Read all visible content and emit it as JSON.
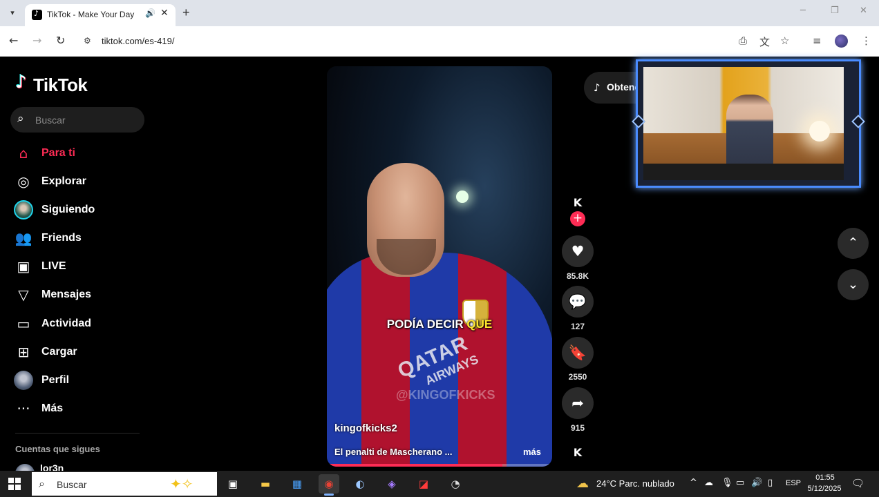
{
  "browser": {
    "tab_title": "TikTok - Make Your Day",
    "url": "tiktok.com/es-419/",
    "icons": [
      "tab-list-icon",
      "tiktok-favicon",
      "speaker-icon",
      "close-icon",
      "plus-icon",
      "minimize-icon",
      "maximize-icon",
      "close-window-icon",
      "back-icon",
      "forward-icon",
      "reload-icon",
      "site-info-icon",
      "install-icon",
      "translate-icon",
      "star-icon",
      "media-icon",
      "profile-avatar",
      "menu-icon"
    ]
  },
  "sidebar": {
    "logo": "TikTok",
    "search_placeholder": "Buscar",
    "nav": [
      {
        "label": "Para ti",
        "icon": "home-icon",
        "active": true
      },
      {
        "label": "Explorar",
        "icon": "compass-icon"
      },
      {
        "label": "Siguiendo",
        "icon": "following-avatar"
      },
      {
        "label": "Friends",
        "icon": "friends-icon"
      },
      {
        "label": "LIVE",
        "icon": "live-icon"
      },
      {
        "label": "Mensajes",
        "icon": "send-icon"
      },
      {
        "label": "Actividad",
        "icon": "activity-icon"
      },
      {
        "label": "Cargar",
        "icon": "upload-icon"
      },
      {
        "label": "Perfil",
        "icon": "profile-avatar"
      },
      {
        "label": "Más",
        "icon": "more-icon"
      }
    ],
    "following_title": "Cuentas que sigues",
    "following_accounts": [
      "lor3n"
    ]
  },
  "video": {
    "caption_text": "PODÍA DECIR",
    "caption_highlight": "QUE",
    "watermark": "@KINGOFKICKS",
    "sponsor_text": "QATAR",
    "sponsor_sub": "AIRWAYS",
    "author": "kingofkicks2",
    "description": "El penalti de Mascherano ...",
    "more_label": "más",
    "progress": 0.78
  },
  "actions": {
    "creator_badge": "K",
    "likes": "85.8K",
    "comments": "127",
    "saves": "2550",
    "shares": "915"
  },
  "get_app": {
    "label": "Obtener app"
  },
  "taskbar": {
    "search_label": "Buscar",
    "apps": [
      "task-view-icon",
      "file-explorer-icon",
      "store-icon",
      "chrome-icon",
      "steam-icon",
      "copilot-icon",
      "amd-icon",
      "capture-icon"
    ],
    "weather_temp": "24°C",
    "weather_desc": "Parc. nublado",
    "language": "ESP",
    "time": "01:55",
    "date": "5/12/2025"
  },
  "colors": {
    "accent": "#fe2c55",
    "caption_highlight": "#ffe62e",
    "webcam_border": "#4a8cff"
  }
}
